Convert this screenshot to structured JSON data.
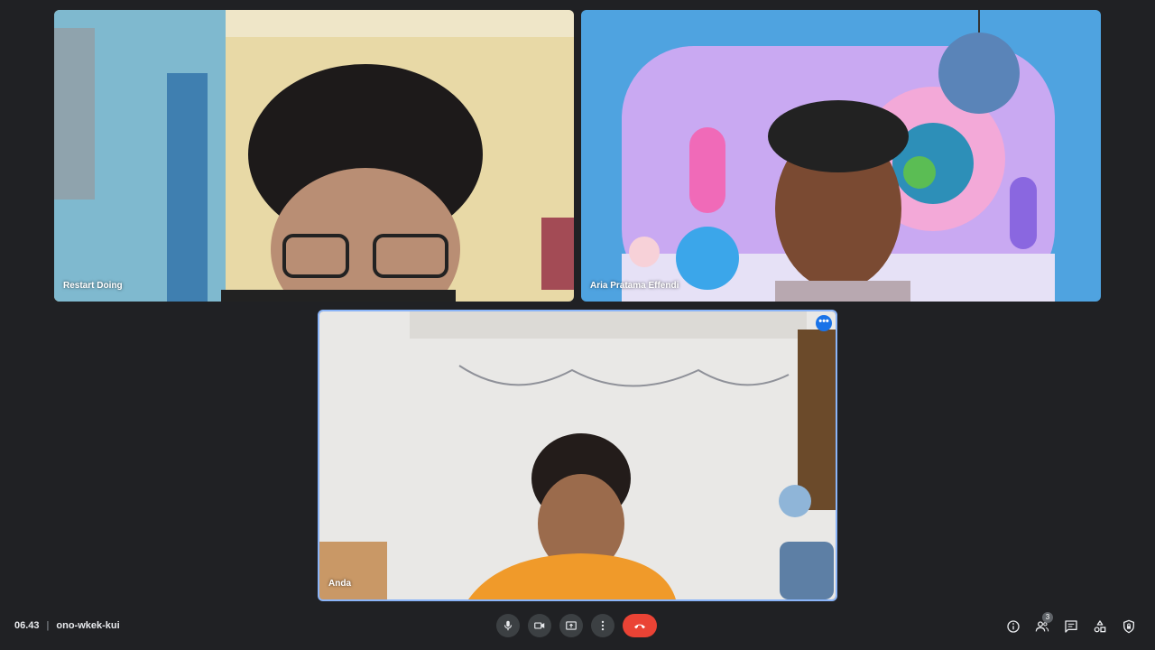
{
  "participants": [
    {
      "name": "Restart Doing"
    },
    {
      "name": "Aria Pratama Effendi"
    },
    {
      "name": "Anda"
    }
  ],
  "tile_menu_label": "•••",
  "meeting": {
    "time": "06.43",
    "separator": "|",
    "code": "ono-wkek-kui"
  },
  "people_count": "3",
  "colors": {
    "background": "#202124",
    "control_bg": "#3c4043",
    "end_call": "#ea4335",
    "active_border": "#8ab4f8"
  },
  "icons": {
    "controls": [
      "microphone-icon",
      "camera-icon",
      "present-screen-icon",
      "more-options-icon",
      "end-call-icon"
    ],
    "right": [
      "info-icon",
      "people-icon",
      "chat-icon",
      "activities-icon",
      "host-controls-icon"
    ]
  }
}
